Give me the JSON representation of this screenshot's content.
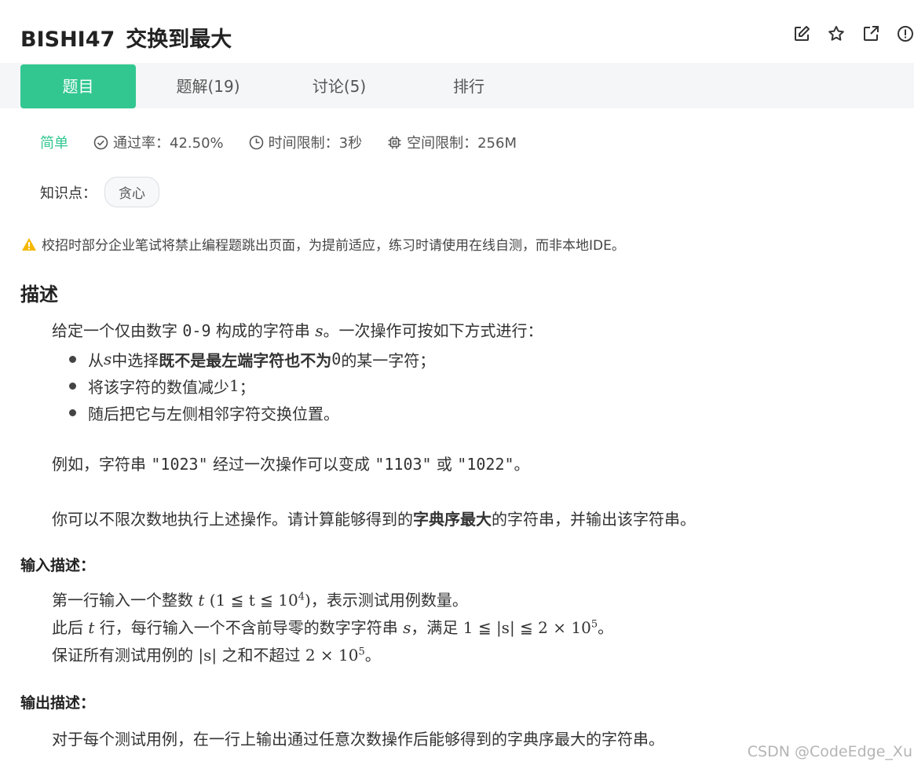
{
  "header": {
    "problem_id": "BISHI47",
    "problem_title": "交换到最大",
    "icons": [
      "edit-icon",
      "star-icon",
      "external-link-icon",
      "info-icon"
    ]
  },
  "tabs": [
    {
      "label": "题目",
      "active": true
    },
    {
      "label": "题解(19)",
      "active": false
    },
    {
      "label": "讨论(5)",
      "active": false
    },
    {
      "label": "排行",
      "active": false
    }
  ],
  "meta": {
    "difficulty": "简单",
    "pass_rate": "通过率：42.50%",
    "time_limit": "时间限制：3秒",
    "memory_limit": "空间限制：256M"
  },
  "knowledge": {
    "label": "知识点：",
    "tag": "贪心"
  },
  "warning": "校招时部分企业笔试将禁止编程题跳出页面，为提前适应，练习时请使用在线自测，而非本地IDE。",
  "description": {
    "heading": "描述",
    "intro_a": "给定一个仅由数字 ",
    "intro_digits": "0-9",
    "intro_b": " 构成的字符串 ",
    "intro_var": "s",
    "intro_c": "。一次操作可按如下方式进行：",
    "bullet1_a": "从 ",
    "bullet1_var": "s",
    "bullet1_b": " 中选择",
    "bullet1_bold": "既不是最左端字符也不为",
    "bullet1_zero": " 0 ",
    "bullet1_c": "的某一字符；",
    "bullet2_a": "将该字符的数值减少 ",
    "bullet2_num": "1",
    "bullet2_b": "；",
    "bullet3": "随后把它与左侧相邻字符交换位置。",
    "example_a": "例如，字符串 ",
    "example_s1": "\"1023\"",
    "example_b": " 经过一次操作可以变成 ",
    "example_s2": "\"1103\"",
    "example_c": " 或 ",
    "example_s3": "\"1022\"",
    "example_d": "。",
    "task_a": "你可以不限次数地执行上述操作。请计算能够得到的",
    "task_bold": "字典序最大",
    "task_b": "的字符串，并输出该字符串。"
  },
  "input": {
    "heading": "输入描述：",
    "line1_a": "第一行输入一个整数 ",
    "line1_math": "t",
    "line1_expr": "(1 ≦ t ≦ 10",
    "line1_exp": "4",
    "line1_close": ")",
    "line1_b": "，表示测试用例数量。",
    "line2_a": "此后 ",
    "line2_var": "t",
    "line2_b": " 行，每行输入一个不含前导零的数字字符串 ",
    "line2_var2": "s",
    "line2_c": "，满足 ",
    "line2_expr": "1 ≦ |s| ≦ 2 × 10",
    "line2_exp": "5",
    "line2_d": "。",
    "line3_a": "保证所有测试用例的 ",
    "line3_expr": "|s|",
    "line3_b": " 之和不超过 ",
    "line3_expr2": "2 × 10",
    "line3_exp": "5",
    "line3_c": "。"
  },
  "output": {
    "heading": "输出描述：",
    "text": "对于每个测试用例，在一行上输出通过任意次数操作后能够得到的字典序最大的字符串。"
  },
  "watermark": "CSDN @CodeEdge_Xu",
  "colors": {
    "accent": "#32c791",
    "warning": "#f5b800",
    "tab_bar_bg": "#f5f6f7"
  }
}
